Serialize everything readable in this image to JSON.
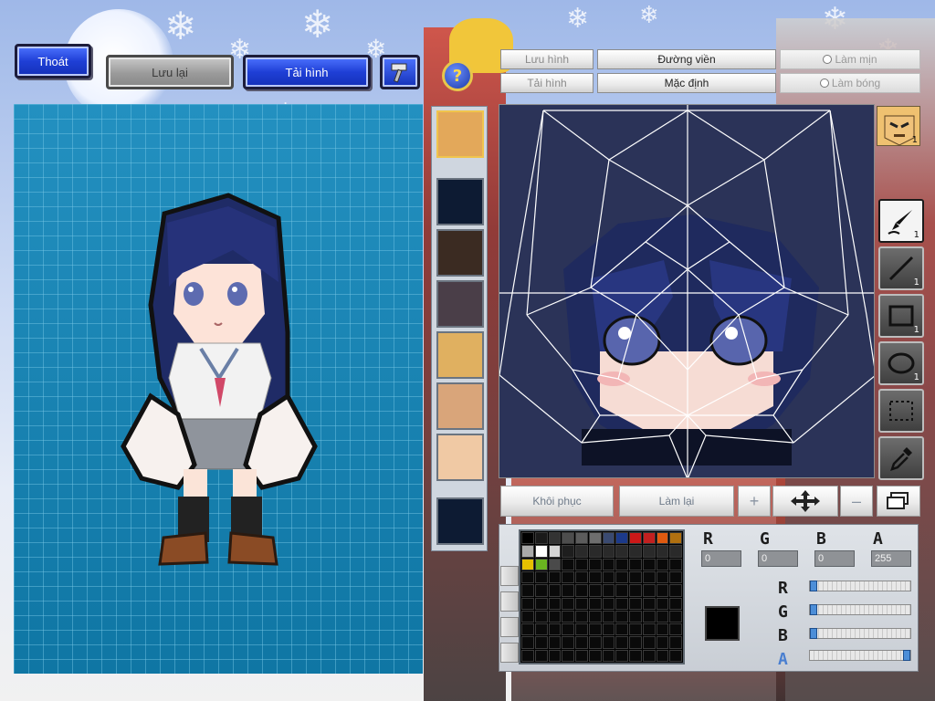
{
  "top_buttons": {
    "exit_label": "Thoát",
    "save_label": "Lưu lại",
    "reload_label": "Tải hình"
  },
  "face_panel": {
    "buttons": {
      "save_image": "Lưu hình",
      "load_image": "Tải hình",
      "outline": "Đường viền",
      "default": "Mặc định",
      "smooth": "Làm mịn",
      "shine": "Làm bóng"
    }
  },
  "tools": [
    {
      "icon": "brush-icon",
      "badge": "1"
    },
    {
      "icon": "line-icon",
      "badge": "1"
    },
    {
      "icon": "rectangle-icon",
      "badge": "1"
    },
    {
      "icon": "ellipse-icon",
      "badge": "1"
    },
    {
      "icon": "selection-icon",
      "badge": ""
    },
    {
      "icon": "eyedropper-icon",
      "badge": ""
    }
  ],
  "face_thumb_badge": "1",
  "controls": {
    "restore_label": "Khôi phục",
    "redo_label": "Làm lại"
  },
  "color": {
    "r_value": "0",
    "g_value": "0",
    "b_value": "0",
    "a_value": "255",
    "current_color": "#000000",
    "palette_row1": [
      "#000000",
      "#1a1a1a",
      "#333333",
      "#4d4d4d",
      "#5c5c5c",
      "#6e6e6e",
      "#3a4a70",
      "#1c3a8a",
      "#cc1818",
      "#c22020",
      "#e05a10",
      "#b07010"
    ],
    "palette_row2": [
      "#aaaaaa",
      "#ffffff",
      "#d5d5d5",
      "#1e1e1e",
      "#2a2a2a",
      "#2a2a2a",
      "#2a2a2a",
      "#2a2a2a",
      "#2a2a2a",
      "#2a2a2a",
      "#2a2a2a",
      "#2a2a2a"
    ],
    "palette_row3": [
      "#e6c000",
      "#6ab520",
      "#4a4a4a",
      "#0a0a0a",
      "#0a0a0a",
      "#0a0a0a",
      "#0a0a0a",
      "#0a0a0a",
      "#0a0a0a",
      "#0a0a0a",
      "#0a0a0a",
      "#0a0a0a"
    ]
  }
}
